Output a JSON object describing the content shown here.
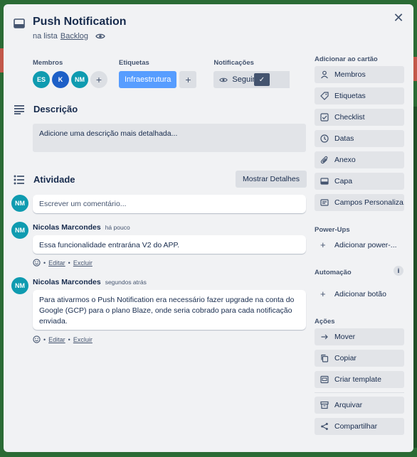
{
  "card": {
    "title": "Push Notification",
    "list_prefix": "na lista",
    "list_name": "Backlog"
  },
  "meta": {
    "members_label": "Membros",
    "members": [
      "ES",
      "K",
      "NM"
    ],
    "labels_label": "Etiquetas",
    "label_chip": "Infraestrutura",
    "notifications_label": "Notificações",
    "follow_label": "Seguindo"
  },
  "description": {
    "heading": "Descrição",
    "placeholder": "Adicione uma descrição mais detalhada..."
  },
  "activity": {
    "heading": "Atividade",
    "details_button": "Mostrar Detalhes",
    "current_user_initials": "NM",
    "comment_placeholder": "Escrever um comentário...",
    "comments": [
      {
        "initials": "NM",
        "author": "Nicolas Marcondes",
        "time": "há pouco",
        "text": "Essa funcionalidade entrarána V2 do APP.",
        "edit": "Editar",
        "delete": "Excluir"
      },
      {
        "initials": "NM",
        "author": "Nicolas Marcondes",
        "time": "segundos atrás",
        "text": "Para ativarmos o Push Notification era necessário fazer upgrade na conta do Google (GCP) para o plano Blaze, onde seria cobrado para cada notificação enviada.",
        "edit": "Editar",
        "delete": "Excluir"
      }
    ],
    "separator": "•"
  },
  "sidebar": {
    "add_to_card_label": "Adicionar ao cartão",
    "add_items": [
      {
        "label": "Membros",
        "icon": "user-icon"
      },
      {
        "label": "Etiquetas",
        "icon": "tag-icon"
      },
      {
        "label": "Checklist",
        "icon": "checklist-icon"
      },
      {
        "label": "Datas",
        "icon": "clock-icon"
      },
      {
        "label": "Anexo",
        "icon": "paperclip-icon"
      },
      {
        "label": "Capa",
        "icon": "cover-icon"
      },
      {
        "label": "Campos Personaliza...",
        "icon": "custom-fields-icon"
      }
    ],
    "powerups_label": "Power-Ups",
    "add_powerup": "Adicionar power-...",
    "automation_label": "Automação",
    "add_button": "Adicionar botão",
    "actions_label": "Ações",
    "action_items": [
      {
        "label": "Mover",
        "icon": "arrow-right-icon"
      },
      {
        "label": "Copiar",
        "icon": "copy-icon"
      },
      {
        "label": "Criar template",
        "icon": "template-icon"
      }
    ],
    "archive": {
      "label": "Arquivar",
      "icon": "archive-icon"
    },
    "share": {
      "label": "Compartilhar",
      "icon": "share-icon"
    }
  },
  "colors": {
    "board_background": "#2b6b35",
    "modal_background": "#f1f2f4",
    "label_blue": "#579dff",
    "avatar_teal": "#0f9bb0",
    "avatar_blue": "#1d5fc7"
  }
}
